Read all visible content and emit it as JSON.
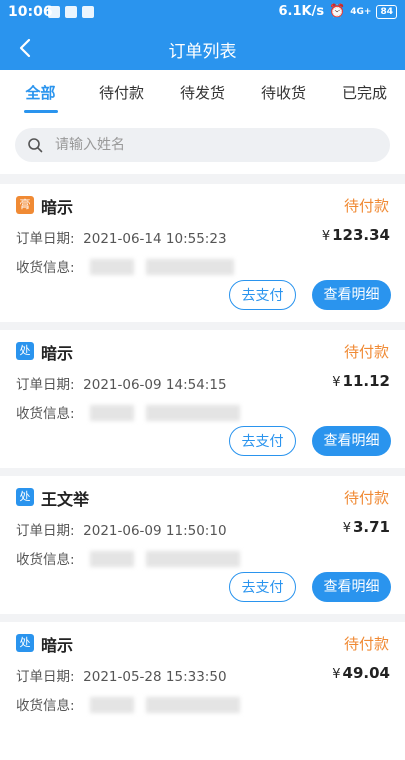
{
  "status_bar": {
    "time": "10:06",
    "speed": "6.1K/s",
    "battery": "84",
    "net": "4G+"
  },
  "header": {
    "title": "订单列表"
  },
  "tabs": [
    {
      "label": "全部",
      "active": true
    },
    {
      "label": "待付款",
      "active": false
    },
    {
      "label": "待发货",
      "active": false
    },
    {
      "label": "待收货",
      "active": false
    },
    {
      "label": "已完成",
      "active": false
    }
  ],
  "search": {
    "placeholder": "请输入姓名"
  },
  "labels": {
    "order_date": "订单日期:",
    "receive_info": "收货信息:",
    "pay_button": "去支付",
    "detail_button": "查看明细",
    "currency": "¥"
  },
  "colors": {
    "primary": "#2a94ee",
    "pending": "#f08a34"
  },
  "orders": [
    {
      "tag": "膏",
      "tag_color": "#f08a34",
      "name": "暗示",
      "status": "待付款",
      "date": "2021-06-14 10:55:23",
      "amount": "123.34"
    },
    {
      "tag": "处",
      "tag_color": "#2a94ee",
      "name": "暗示",
      "status": "待付款",
      "date": "2021-06-09 14:54:15",
      "amount": "11.12"
    },
    {
      "tag": "处",
      "tag_color": "#2a94ee",
      "name": "王文举",
      "status": "待付款",
      "date": "2021-06-09 11:50:10",
      "amount": "3.71"
    },
    {
      "tag": "处",
      "tag_color": "#2a94ee",
      "name": "暗示",
      "status": "待付款",
      "date": "2021-05-28 15:33:50",
      "amount": "49.04"
    }
  ]
}
